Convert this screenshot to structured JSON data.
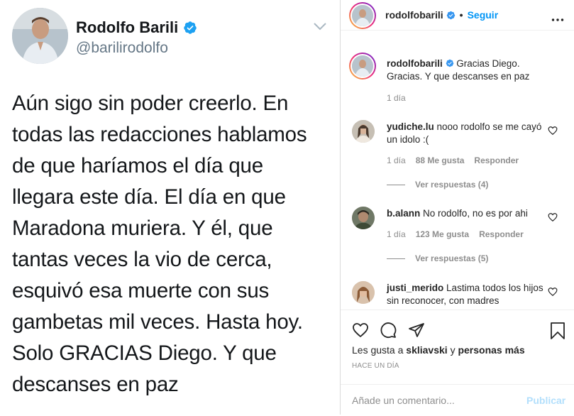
{
  "tweet": {
    "name": "Rodolfo Barili",
    "handle": "@barilirodolfo",
    "text": "Aún sigo sin poder creerlo. En todas las redacciones hablamos de que haríamos el día que llegara este día. El día en que Maradona muriera. Y él, que tantas veces la vio de cerca, esquivó esa muerte con sus gambetas mil veces. Hasta hoy. Solo GRACIAS Diego. Y que descanses en paz",
    "lines": [
      "Aún sigo sin poder creerlo. En",
      "todas las redacciones hablamos",
      "de que haríamos el día que",
      "llegara este día. El día en que",
      "Maradona muriera. Y él, que",
      "tantas veces la vio de cerca,",
      "esquivó esa muerte con sus",
      "gambetas mil veces. Hasta hoy.",
      "Solo GRACIAS Diego. Y que",
      "descanses en paz"
    ],
    "verified_color": "#1da1f2"
  },
  "instagram": {
    "header": {
      "username": "rodolfobarili",
      "separator": "•",
      "follow_label": "Seguir"
    },
    "caption": {
      "username": "rodolfobarili",
      "text": "Gracias Diego. Gracias. Y que descanses en paz",
      "time": "1 día"
    },
    "comments": [
      {
        "username": "yudiche.lu",
        "text": "nooo rodolfo se me cayó un idolo :(",
        "time": "1 día",
        "likes": "88 Me gusta",
        "reply": "Responder",
        "view_replies": "Ver respuestas (4)"
      },
      {
        "username": "b.alann",
        "text": "No rodolfo, no es por ahi",
        "time": "1 día",
        "likes": "123 Me gusta",
        "reply": "Responder",
        "view_replies": "Ver respuestas (5)"
      },
      {
        "username": "justi_merido",
        "text": "Lastima todos los hijos sin reconocer, con madres"
      }
    ],
    "likes_prefix": "Les gusta a",
    "likes_user": "skliavski",
    "likes_conj": "y",
    "likes_more": "personas más",
    "date": "HACE UN DÍA",
    "add_comment_placeholder": "Añade un comentario...",
    "post_label": "Publicar",
    "accent": "#0095f6"
  }
}
